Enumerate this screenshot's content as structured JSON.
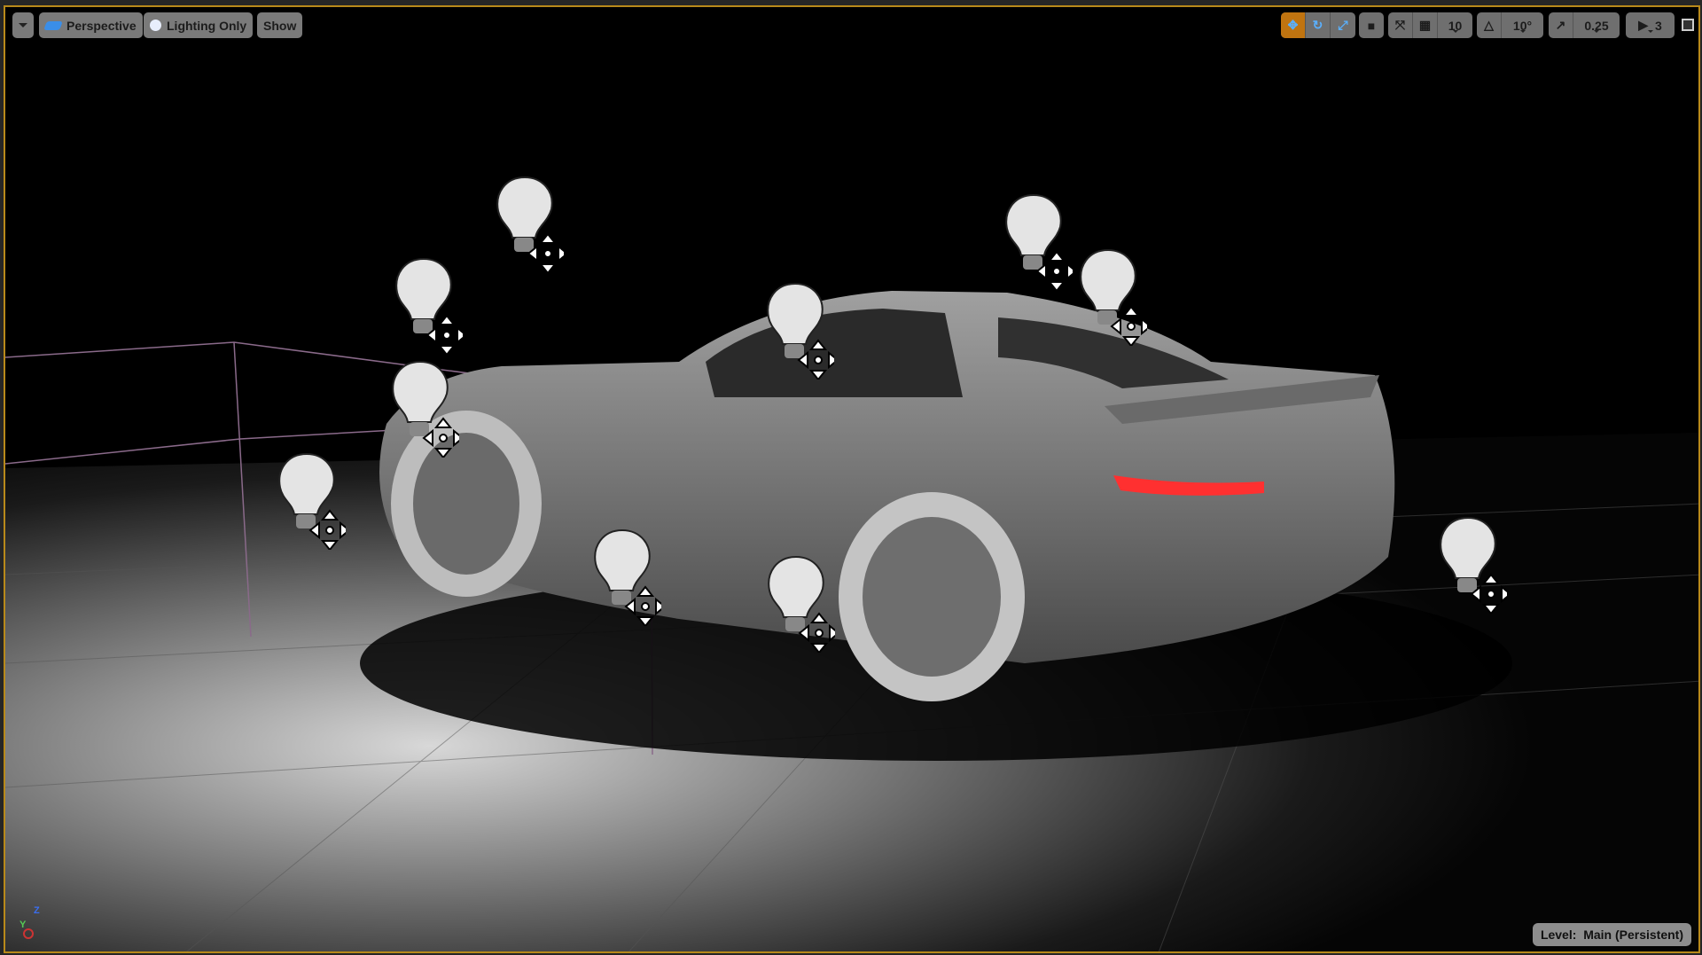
{
  "toolbar_left": {
    "menu_icon": "chevron-down-icon",
    "perspective_label": "Perspective",
    "lighting_label": "Lighting Only",
    "show_label": "Show"
  },
  "toolbar_right": {
    "grid_snap_value": "10",
    "rotation_snap_value": "10°",
    "scale_snap_value": "0.25",
    "camera_speed_value": "3",
    "active_tool": "translate"
  },
  "status": {
    "level_label": "Level:",
    "level_value": "Main (Persistent)"
  },
  "axis": {
    "z": "Z",
    "y": "Y"
  },
  "colors": {
    "accent": "#c07410",
    "border": "#b8891a"
  }
}
